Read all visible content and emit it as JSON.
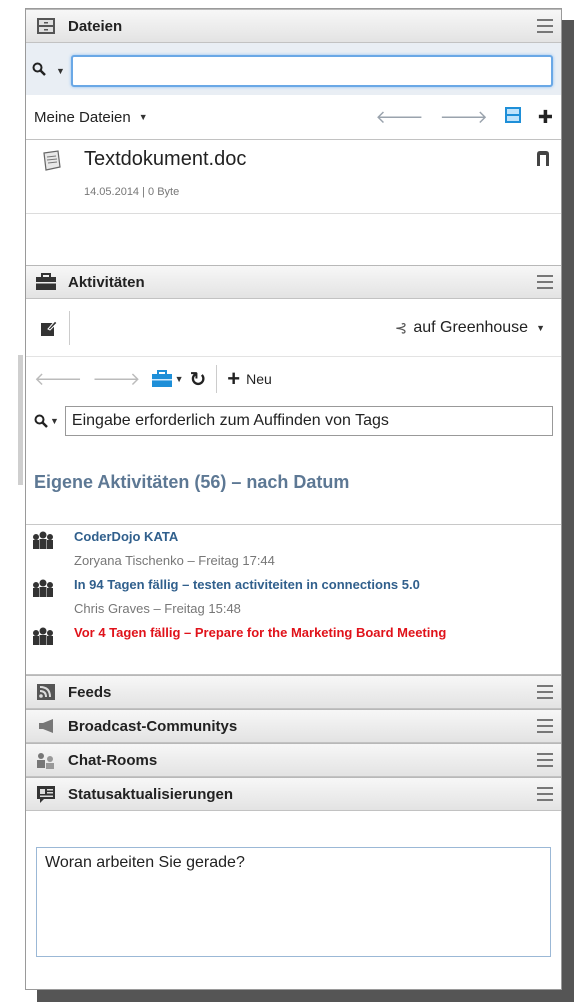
{
  "files": {
    "header_title": "Dateien",
    "search_value": "",
    "scope_label": "Meine Dateien",
    "items": [
      {
        "name": "Textdokument.doc",
        "meta": "14.05.2014 | 0 Byte"
      }
    ]
  },
  "activities": {
    "header_title": "Aktivitäten",
    "greenhouse_label": "auf Greenhouse",
    "new_label": "Neu",
    "search_value": "Eingabe erforderlich zum Auffinden von Tags",
    "heading": "Eigene Aktivitäten (56) – nach Datum",
    "items": [
      {
        "title": "CoderDojo KATA",
        "meta": "Zoryana Tischenko – Freitag 17:44",
        "overdue": false
      },
      {
        "title": "In 94 Tagen fällig – testen activiteiten in connections 5.0",
        "meta": "Chris Graves – Freitag 15:48",
        "overdue": false
      },
      {
        "title": "Vor 4 Tagen fällig – Prepare for the Marketing Board Meeting",
        "meta": "",
        "overdue": true
      }
    ]
  },
  "feeds": {
    "header_title": "Feeds"
  },
  "broadcast": {
    "header_title": "Broadcast-Communitys"
  },
  "chat": {
    "header_title": "Chat-Rooms"
  },
  "status": {
    "header_title": "Statusaktualisierungen",
    "input_value": "Woran arbeiten Sie gerade?"
  },
  "colors": {
    "link_blue": "#305f8c",
    "heading_slate": "#5d7894",
    "overdue_red": "#e0121a",
    "focus_blue": "#6aa8e6"
  }
}
